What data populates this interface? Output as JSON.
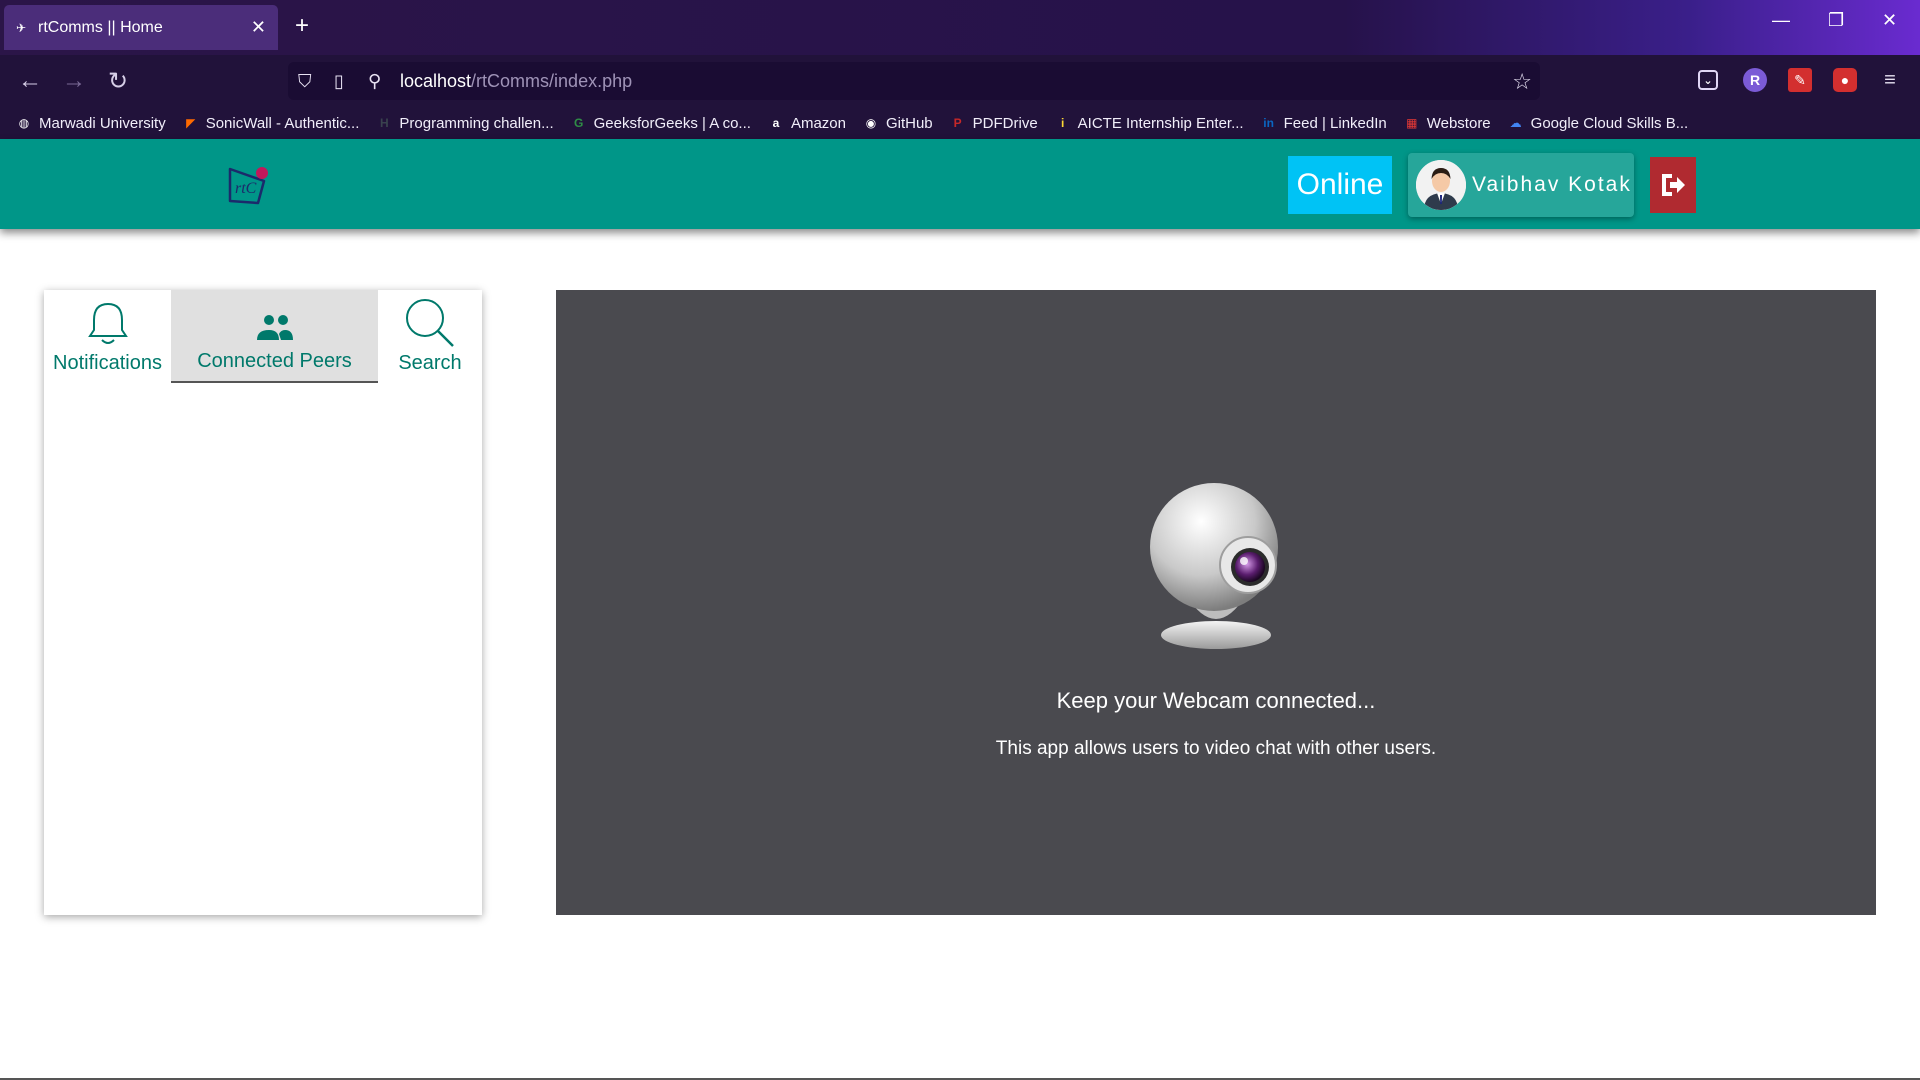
{
  "browser": {
    "tab_title": "rtComms || Home",
    "url_host": "localhost",
    "url_path": "/rtComms/index.php",
    "bookmarks": [
      {
        "label": "Marwadi University",
        "icon": "globe-icon",
        "color": "#ffffff"
      },
      {
        "label": "SonicWall - Authentic...",
        "icon": "sonicwall-icon",
        "color": "#ff6a00"
      },
      {
        "label": "Programming challen...",
        "icon": "hackerrank-icon",
        "color": "#39424e"
      },
      {
        "label": "GeeksforGeeks | A co...",
        "icon": "gfg-icon",
        "color": "#2f8d46"
      },
      {
        "label": "Amazon",
        "icon": "amazon-icon",
        "color": "#ffffff"
      },
      {
        "label": "GitHub",
        "icon": "github-icon",
        "color": "#ffffff"
      },
      {
        "label": "PDFDrive",
        "icon": "pdfdrive-icon",
        "color": "#c62828"
      },
      {
        "label": "AICTE Internship Enter...",
        "icon": "aicte-icon",
        "color": "#fdd835"
      },
      {
        "label": "Feed | LinkedIn",
        "icon": "linkedin-icon",
        "color": "#0a66c2"
      },
      {
        "label": "Webstore",
        "icon": "webstore-icon",
        "color": "#e53935"
      },
      {
        "label": "Google Cloud Skills B...",
        "icon": "google-cloud-icon",
        "color": "#4285f4"
      }
    ]
  },
  "header": {
    "status": "Online",
    "user_name": "Vaibhav Kotak",
    "colors": {
      "bar": "#009688",
      "status": "#00c3f5",
      "logout": "#b02a30"
    }
  },
  "sidebar": {
    "tabs": [
      {
        "label": "Notifications",
        "icon": "bell-icon"
      },
      {
        "label": "Connected Peers",
        "icon": "people-icon",
        "active": true
      },
      {
        "label": "Search",
        "icon": "search-icon"
      }
    ]
  },
  "main": {
    "title": "Keep your Webcam connected...",
    "description": "This app allows users to video chat with other users."
  }
}
